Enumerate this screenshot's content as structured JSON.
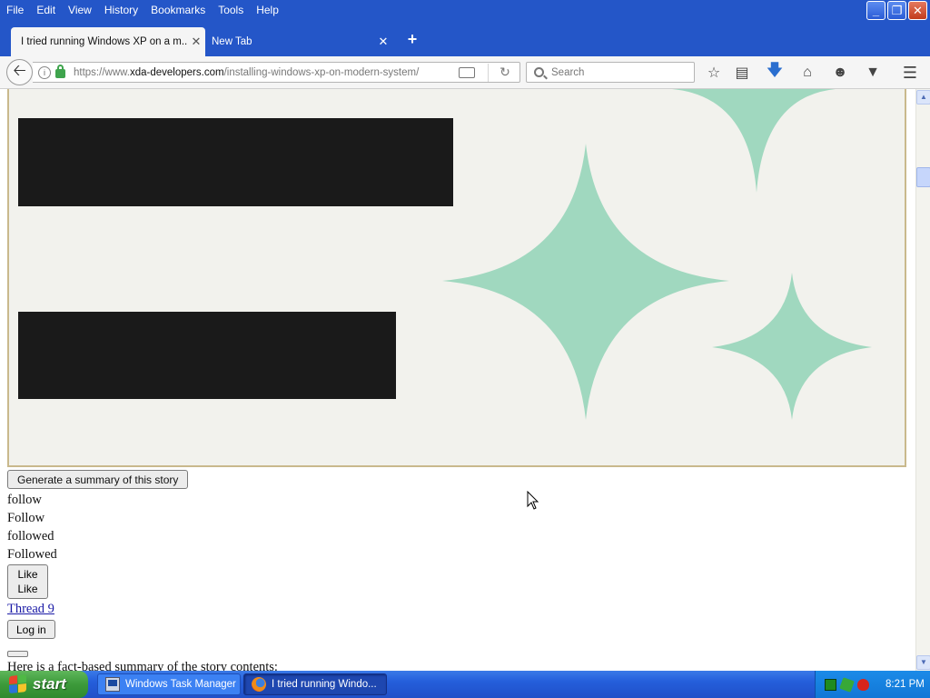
{
  "menubar": {
    "items": [
      "File",
      "Edit",
      "View",
      "History",
      "Bookmarks",
      "Tools",
      "Help"
    ]
  },
  "window_controls": {
    "minimize": "_",
    "maximize": "❐",
    "close": "✕"
  },
  "tabs": [
    {
      "title": "I tried running Windows XP on a m...",
      "active": true
    },
    {
      "title": "New Tab",
      "active": false
    }
  ],
  "new_tab_symbol": "+",
  "address_bar": {
    "url_prefix": "https://www.",
    "url_host": "xda-developers.com",
    "url_path": "/installing-windows-xp-on-modern-system/"
  },
  "search_bar": {
    "placeholder": "Search"
  },
  "toolbar_icons": [
    "star-icon",
    "library-icon",
    "download-icon",
    "home-icon",
    "hello-icon",
    "pocket-icon",
    "menu-icon"
  ],
  "page": {
    "summary_button": "Generate a summary of this story",
    "follow_lines": [
      "follow",
      "Follow",
      "followed",
      "Followed"
    ],
    "like_button": [
      "Like",
      "Like"
    ],
    "thread_link": "Thread 9",
    "login_button": "Log in",
    "summary_intro": "Here is a fact-based summary of the story contents:"
  },
  "colors": {
    "hero_bg": "#f2f2ed",
    "sparkle": "#a0d8bf",
    "blocked_bar": "#1a1a1a",
    "xp_blue": "#2456c8"
  },
  "taskbar": {
    "start_label": "start",
    "tasks": [
      {
        "label": "Windows Task Manager",
        "active": false
      },
      {
        "label": "I tried running Windo...",
        "active": true
      }
    ],
    "clock": "8:21 PM"
  }
}
